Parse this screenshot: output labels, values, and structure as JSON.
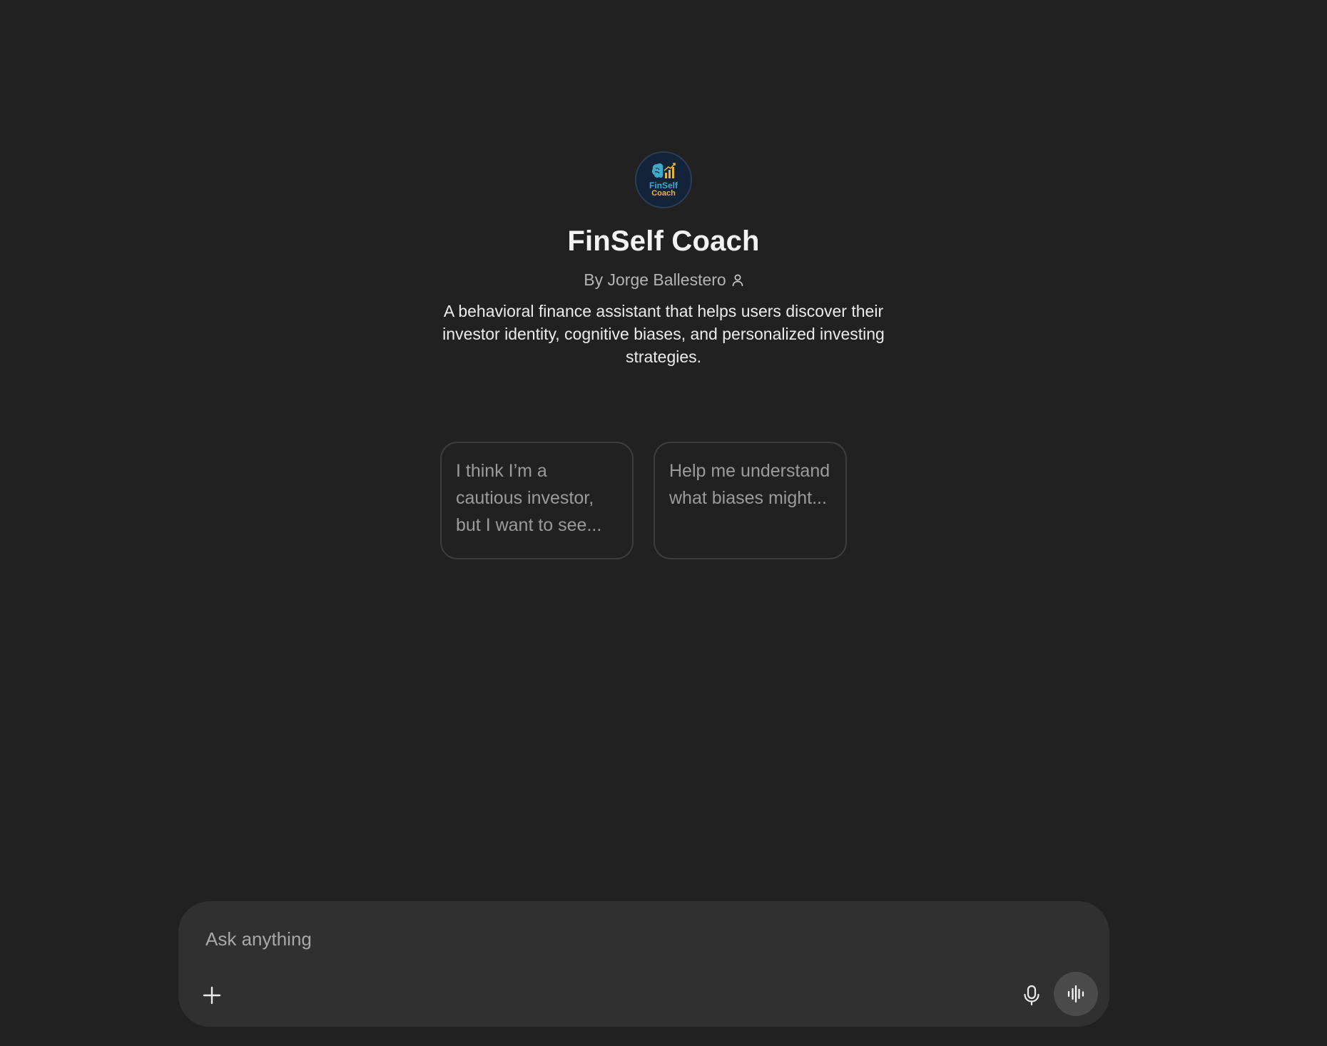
{
  "gpt": {
    "name": "FinSelf Coach",
    "byline": "By Jorge Ballestero",
    "description": "A behavioral finance assistant that helps users discover their investor identity, cognitive biases, and personalized investing strategies.",
    "logo": {
      "line1": "FinSelf",
      "line2": "Coach",
      "icon": "brain-chart-logo"
    }
  },
  "starters": [
    {
      "text": "I think I’m a cautious investor, but I want to see..."
    },
    {
      "text": "Help me understand what biases might..."
    }
  ],
  "composer": {
    "placeholder": "Ask anything",
    "value": "",
    "icons": {
      "attach": "plus-icon",
      "dictate": "microphone-icon",
      "voice": "voice-waveform-icon"
    }
  },
  "colors": {
    "background": "#212121",
    "composer": "#303030",
    "voice_button": "#4a4a4a",
    "logo_blue": "#3fa9c9",
    "logo_gold": "#e8b33a"
  }
}
